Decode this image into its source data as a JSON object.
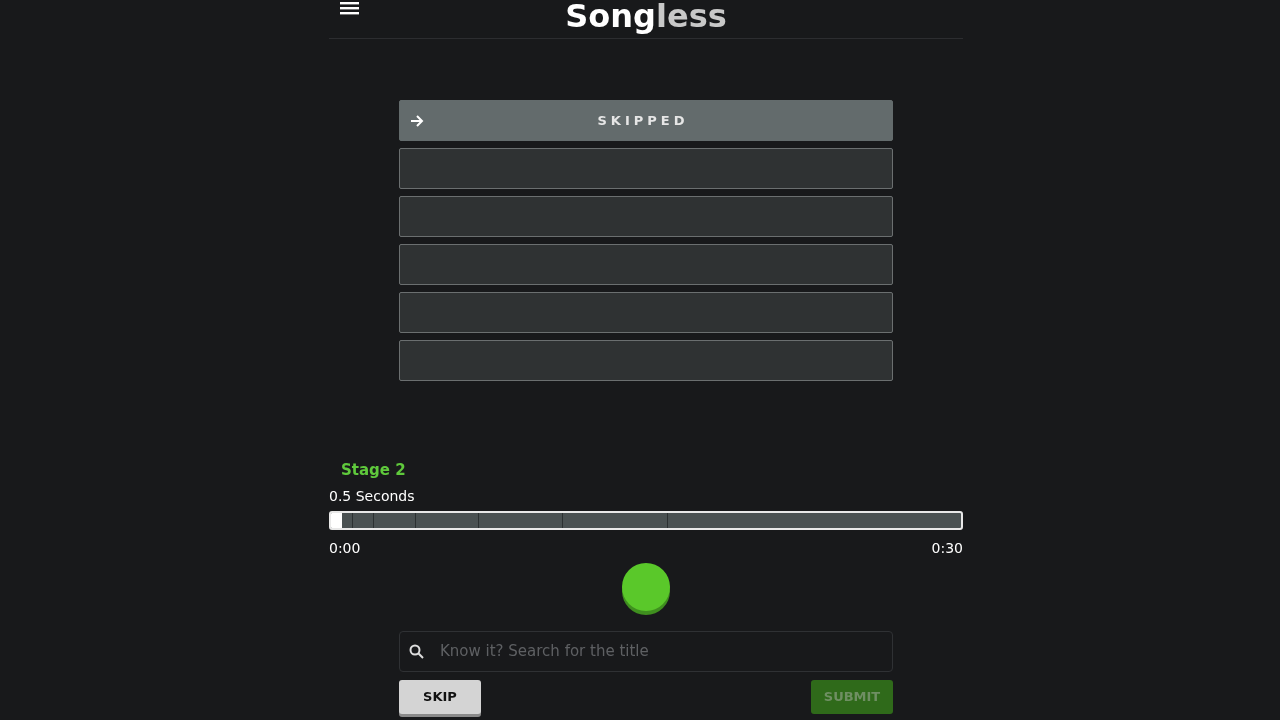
{
  "header": {
    "logo_parts": [
      {
        "text": "Song",
        "kind": "strong"
      },
      {
        "text": "less",
        "kind": "muted"
      }
    ]
  },
  "guesses": [
    {
      "kind": "skipped",
      "text": "SKIPPED"
    },
    {
      "kind": "empty"
    },
    {
      "kind": "empty"
    },
    {
      "kind": "empty"
    },
    {
      "kind": "empty"
    },
    {
      "kind": "empty"
    }
  ],
  "player": {
    "stage": "Stage 2",
    "duration": "0.5 Seconds",
    "level": 0.017,
    "start": "0:00",
    "end": "0:30"
  },
  "search": {
    "placeholder": "Know it? Search for the title"
  },
  "buttons": [
    {
      "label": "SKIP",
      "kind": "skip",
      "disabled": false
    },
    {
      "label": "SUBMIT",
      "kind": "submit",
      "disabled": true
    }
  ]
}
